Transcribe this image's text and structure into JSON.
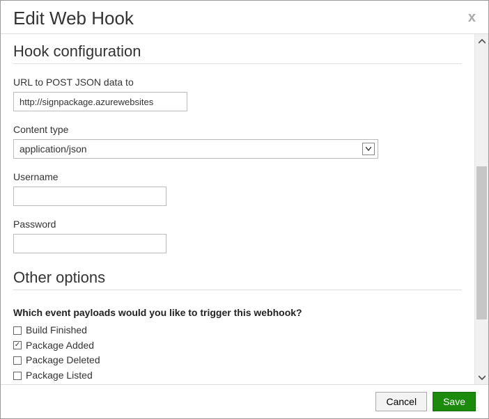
{
  "dialog": {
    "title": "Edit Web Hook",
    "close_icon": "x"
  },
  "section_config": {
    "title": "Hook configuration",
    "url": {
      "label": "URL to POST JSON data to",
      "value": "http://signpackage.azurewebsites"
    },
    "content_type": {
      "label": "Content type",
      "value": "application/json"
    },
    "username": {
      "label": "Username",
      "value": ""
    },
    "password": {
      "label": "Password",
      "value": ""
    }
  },
  "section_other": {
    "title": "Other options",
    "question": "Which event payloads would you like to trigger this webhook?",
    "events": [
      {
        "label": "Build Finished",
        "checked": false
      },
      {
        "label": "Package Added",
        "checked": true
      },
      {
        "label": "Package Deleted",
        "checked": false
      },
      {
        "label": "Package Listed",
        "checked": false
      }
    ]
  },
  "footer": {
    "cancel": "Cancel",
    "save": "Save"
  }
}
